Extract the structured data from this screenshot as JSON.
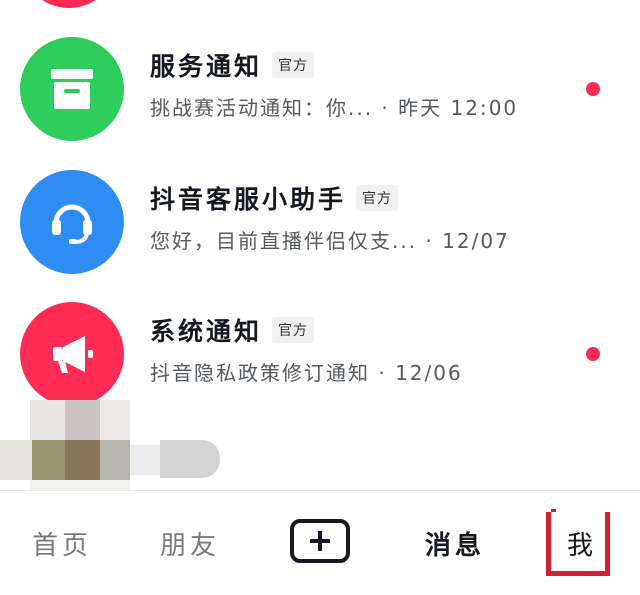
{
  "messages": [
    {
      "title": "服务通知",
      "badge": "官方",
      "preview": "挑战赛活动通知：你... · 昨天 12:00",
      "icon": "inbox-icon",
      "color": "#2ecc5b",
      "unread": true
    },
    {
      "title": "抖音客服小助手",
      "badge": "官方",
      "preview": "您好，目前直播伴侣仅支... · 12/07",
      "icon": "headset-icon",
      "color": "#2f8cf3",
      "unread": false
    },
    {
      "title": "系统通知",
      "badge": "官方",
      "preview": "抖音隐私政策修订通知 · 12/06",
      "icon": "megaphone-icon",
      "color": "#fe2c55",
      "unread": true
    }
  ],
  "tabbar": {
    "home": "首页",
    "friends": "朋友",
    "plus_icon": "plus-icon",
    "messages": "消息",
    "me": "我"
  },
  "colors": {
    "accent": "#fe2c55",
    "highlight_box": "#d42030"
  }
}
